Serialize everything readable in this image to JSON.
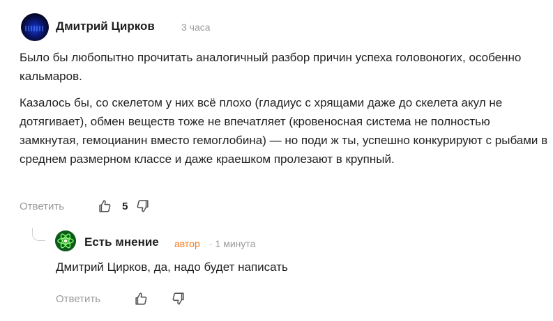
{
  "comment": {
    "author": "Дмитрий Цирков",
    "time": "3 часа",
    "paragraphs": [
      "Было бы любопытно прочитать аналогичный разбор причин успеха головоногих, особенно кальмаров.",
      "Казалось бы, со скелетом у них всё плохо (гладиус с хрящами даже до скелета акул не дотягивает), обмен веществ тоже не впечатляет (кровеносная система не полностью замкнутая, гемоцианин вместо гемоглобина) — но поди ж ты, успешно конкурируют с рыбами в среднем размерном классе и даже краешком пролезают в крупный."
    ],
    "reply_label": "Ответить",
    "likes": "5",
    "avatar_icon": "user-avatar-icon",
    "like_icon": "thumbs-up-icon",
    "dislike_icon": "thumbs-down-icon"
  },
  "reply": {
    "author": "Есть мнение",
    "badge": "автор",
    "time": "· 1 минута",
    "text": "Дмитрий Цирков, да, надо будет написать",
    "reply_label": "Ответить",
    "avatar_icon": "atom-avatar-icon"
  },
  "colors": {
    "text": "#1f1f1f",
    "muted": "#9a9a9a",
    "author_badge": "#f07a1a",
    "avatar_green": "#0e5a1a"
  }
}
